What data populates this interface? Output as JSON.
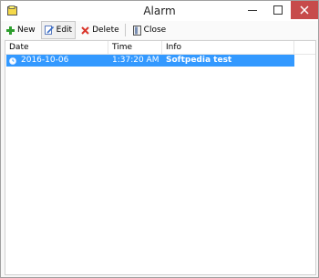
{
  "window": {
    "title": "Alarm"
  },
  "toolbar": {
    "new_label": "New",
    "edit_label": "Edit",
    "delete_label": "Delete",
    "close_label": "Close"
  },
  "table": {
    "columns": [
      "Date",
      "Time",
      "Info"
    ],
    "rows": [
      {
        "date": "2016-10-06",
        "time": "1:37:20 AM",
        "info": "Softpedia test",
        "selected": true
      }
    ]
  },
  "colors": {
    "selection": "#3399ff",
    "close_button": "#c74b4b",
    "new_icon": "#2e9e2e",
    "delete_icon": "#d9352a"
  }
}
